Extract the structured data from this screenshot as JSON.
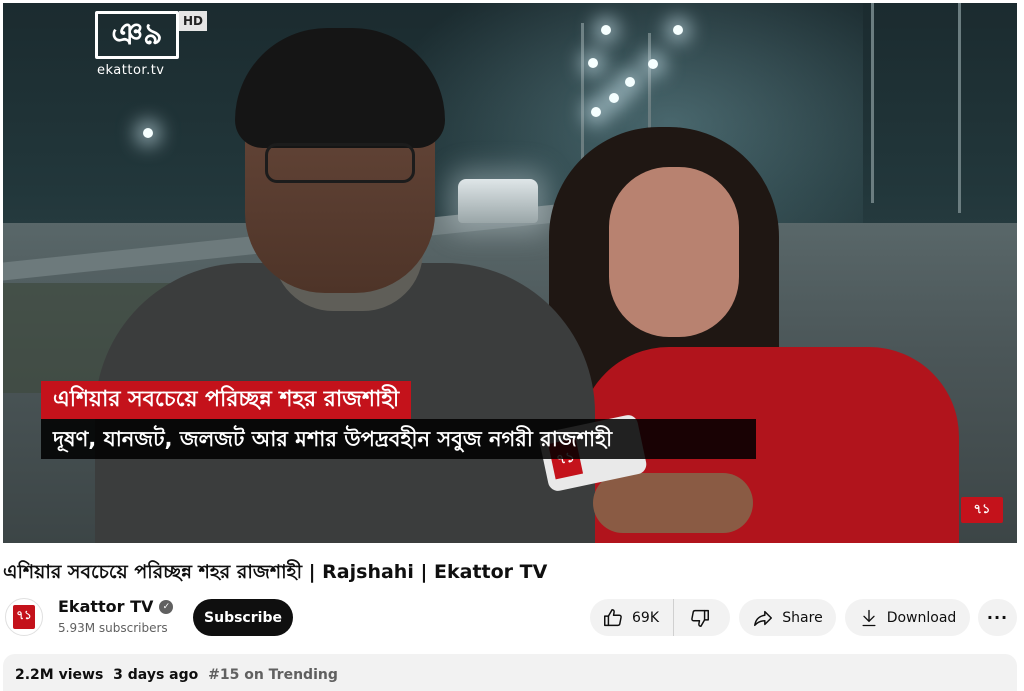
{
  "player": {
    "logo_text": "ঞ৯",
    "logo_badge": "HD",
    "logo_url": "ekattor.tv",
    "headline": "এশিয়ার সবচেয়ে পরিচ্ছন্ন শহর রাজশাহী",
    "subline": "দূষণ, যানজট, জলজট আর মশার উপদ্রবহীন সবুজ নগরী রাজশাহী",
    "mic_logo": "৭১",
    "corner_logo": "৭১"
  },
  "video": {
    "title": "এশিয়ার সবচেয়ে পরিচ্ছন্ন শহর রাজশাহী | Rajshahi | Ekattor TV"
  },
  "channel": {
    "avatar_text": "৭১",
    "name": "Ekattor TV",
    "subscribers": "5.93M subscribers",
    "subscribe_label": "Subscribe"
  },
  "actions": {
    "likes": "69K",
    "share_label": "Share",
    "download_label": "Download",
    "more_label": "···"
  },
  "description": {
    "views": "2.2M views",
    "date": "3 days ago",
    "trending": "#15 on Trending"
  },
  "colors": {
    "brand_red": "#c4121b",
    "subscribe_bg": "#0f0f0f",
    "pill_bg": "#f2f2f2"
  }
}
